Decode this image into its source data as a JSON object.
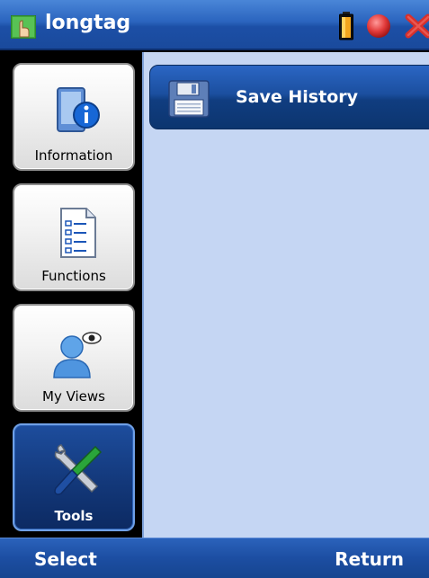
{
  "titlebar": {
    "title": "longtag",
    "icons": [
      "app-icon",
      "battery-icon",
      "record-icon",
      "close-icon"
    ]
  },
  "sidebar": {
    "items": [
      {
        "label": "Information",
        "icon": "information-icon",
        "active": false
      },
      {
        "label": "Functions",
        "icon": "document-list-icon",
        "active": false
      },
      {
        "label": "My Views",
        "icon": "user-view-icon",
        "active": false
      },
      {
        "label": "Tools",
        "icon": "tools-icon",
        "active": true
      }
    ]
  },
  "content": {
    "items": [
      {
        "label": "Save History",
        "icon": "floppy-disk-icon"
      }
    ]
  },
  "softkeys": {
    "left": "Select",
    "right": "Return"
  },
  "colors": {
    "titlebar": "#2a64be",
    "content_bg": "#c5d6f3",
    "active_item": "#13387a",
    "close": "#e2332f"
  }
}
